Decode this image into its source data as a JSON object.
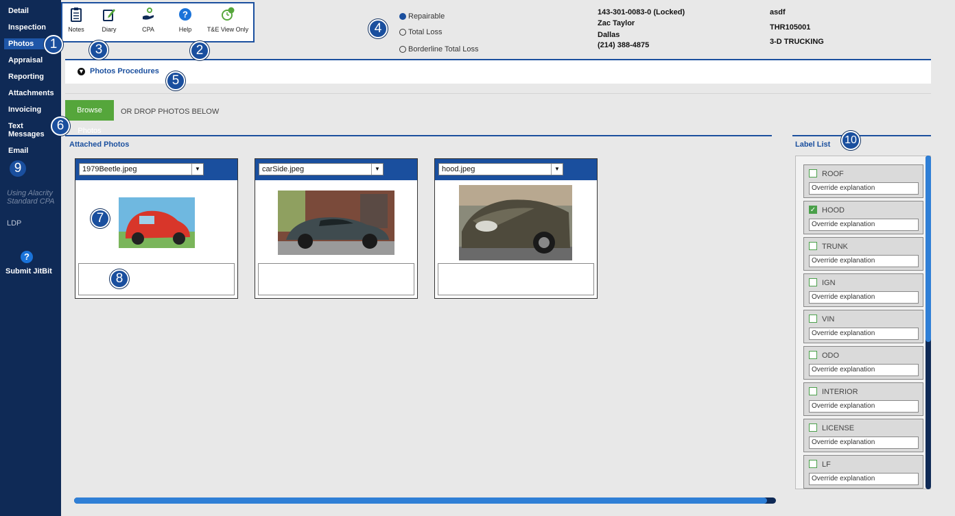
{
  "sidebar": {
    "items": [
      {
        "label": "Detail"
      },
      {
        "label": "Inspection"
      },
      {
        "label": "Photos"
      },
      {
        "label": "Appraisal"
      },
      {
        "label": "Reporting"
      },
      {
        "label": "Attachments"
      },
      {
        "label": "Invoicing"
      },
      {
        "label": "Text Messages"
      },
      {
        "label": "Email"
      }
    ],
    "note": "Using Alacrity Standard CPA",
    "ldp": "LDP",
    "help_glyph": "?",
    "submit": "Submit JitBit"
  },
  "toolbar": {
    "notes": "Notes",
    "diary": "Diary",
    "cpa": "CPA",
    "help": "Help",
    "te_view": "T&E View Only"
  },
  "markers": [
    "1",
    "2",
    "3",
    "4",
    "5",
    "6",
    "7",
    "8",
    "9",
    "10"
  ],
  "status": {
    "options": [
      "Repairable",
      "Total Loss",
      "Borderline Total Loss"
    ],
    "selected": "Repairable"
  },
  "claim": {
    "number": "143-301-0083-0  (Locked)",
    "owner": "Zac Taylor",
    "city": "Dallas",
    "phone": "(214) 388-4875",
    "ref1": "asdf",
    "ref2": "THR105001",
    "company": "3-D TRUCKING"
  },
  "procedures": {
    "label": "Photos Procedures"
  },
  "upload": {
    "browse": "Browse Photos",
    "drop_text": "OR DROP PHOTOS BELOW"
  },
  "attached": {
    "title": "Attached Photos",
    "photos": [
      {
        "filename": "1979Beetle.jpeg",
        "caption": ""
      },
      {
        "filename": "carSide.jpeg",
        "caption": ""
      },
      {
        "filename": "hood.jpeg",
        "caption": ""
      }
    ]
  },
  "label_list": {
    "title": "Label List",
    "items": [
      {
        "name": "ROOF",
        "checked": false,
        "placeholder": "Override explanation"
      },
      {
        "name": "HOOD",
        "checked": true,
        "placeholder": "Override explanation"
      },
      {
        "name": "TRUNK",
        "checked": false,
        "placeholder": "Override explanation"
      },
      {
        "name": "IGN",
        "checked": false,
        "placeholder": "Override explanation"
      },
      {
        "name": "VIN",
        "checked": false,
        "placeholder": "Override explanation"
      },
      {
        "name": "ODO",
        "checked": false,
        "placeholder": "Override explanation"
      },
      {
        "name": "INTERIOR",
        "checked": false,
        "placeholder": "Override explanation"
      },
      {
        "name": "LICENSE",
        "checked": false,
        "placeholder": "Override explanation"
      },
      {
        "name": "LF",
        "checked": false,
        "placeholder": "Override explanation"
      }
    ]
  },
  "colors": {
    "navy": "#0f2a56",
    "accent": "#1a4f9e",
    "green": "#55a63b"
  }
}
